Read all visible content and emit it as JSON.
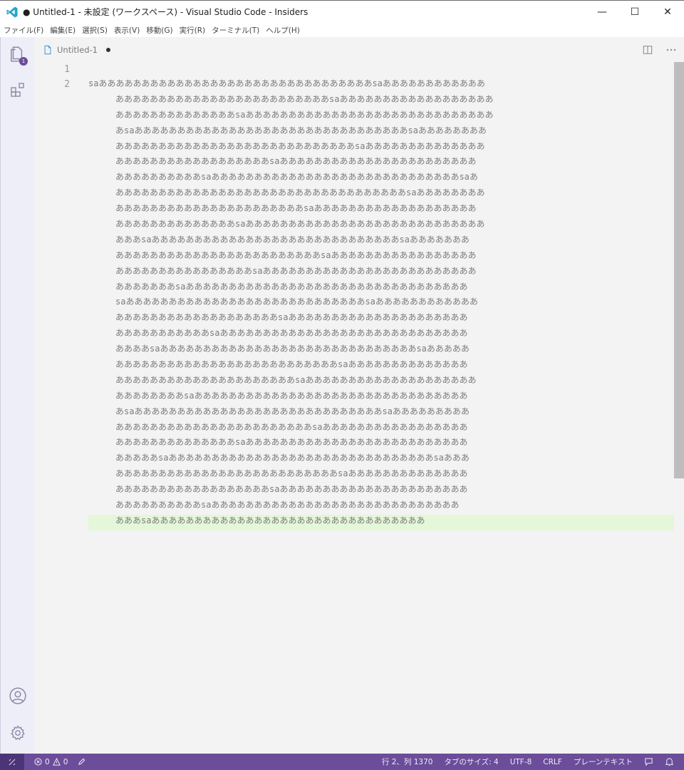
{
  "window": {
    "title": "● Untitled-1 - 未設定 (ワークスペース) - Visual Studio Code - Insiders",
    "controls": {
      "minimize": "—",
      "maximize": "☐",
      "close": "✕"
    }
  },
  "menu": [
    "ファイル(F)",
    "編集(E)",
    "選択(S)",
    "表示(V)",
    "移動(G)",
    "実行(R)",
    "ターミナル(T)",
    "ヘルプ(H)"
  ],
  "activity": {
    "explorer_badge": "1",
    "icons": [
      "explorer-icon",
      "extensions-icon",
      "account-icon",
      "settings-gear-icon"
    ]
  },
  "tab": {
    "label": "Untitled-1",
    "dirty": true
  },
  "editor": {
    "line_numbers": [
      "1",
      "2"
    ],
    "line1": "",
    "line2_visual_rows": [
      "saああああああああああああああああああああああああああああああああsaああああああああああああ",
      "あああああああああああああああああああああああああsaああああああああああああああああああ",
      "ああああああああああああああsaあああああああああああああああああああああああああああああ",
      "あsaああああああああああああああああああああああああああああああああsaああああああああ",
      "ああああああああああああああああああああああああああああsaああああああああああああああ",
      "ああああああああああああああああああsaあああああああああああああああああああああああ",
      "ああああああああああsaあああああああああああああああああああああああああああああsaあ",
      "ああああああああああああああああああああああああああああああああああsaああああああああ",
      "ああああああああああああああああああああああsaあああああああああああああああああああ",
      "ああああああああああああああsaああああああああああああああああああああああああああああ",
      "あああsaあああああああああああああああああああああああああああああsaあああああああ",
      "ああああああああああああああああああああああああsaあああああああああああああああああ",
      "ああああああああああああああああsaあああああああああああああああああああああああああ",
      "あああああああsaあああああああああああああああああああああああああああああああああ",
      "saああああああああああああああああああああああああああああsaああああああああああああ",
      "あああああああああああああああああああsaあああああああああああああああああああああ",
      "あああああああああああsaあああああああああああああああああああああああああああああ",
      "ああああsaああああああああああああああああああああああああああああああsaあああああ",
      "ああああああああああああああああああああああああああsaああああああああああああああ",
      "あああああああああああああああああああああsaああああああああああああああああああああ",
      "ああああああああsaああああああああああああああああああああああああああああああああ",
      "あsaあああああああああああああああああああああああああああああsaあああああああああ",
      "あああああああああああああああああああああああsaあああああああああああああああああ",
      "ああああああああああああああsaああああああああああああああああああああああああああ",
      "あああああsaあああああああああああああああああああああああああああああああsaあああ",
      "ああああああああああああああああああああああああああsaああああああああああああああ",
      "ああああああああああああああああああsaああああああああああああああああああああああ",
      "ああああああああああsaあああああああああああああああああああああああああああああ",
      "あああsaああああああああああああああああああああああああああああああああ"
    ]
  },
  "status": {
    "errors": "0",
    "warnings": "0",
    "position": "行 2、列 1370",
    "tab_size": "タブのサイズ: 4",
    "encoding": "UTF-8",
    "eol": "CRLF",
    "language": "プレーンテキスト"
  },
  "colors": {
    "status_bar": "#6b4d9a",
    "activity_bar": "#eeeef8",
    "editor_bg": "#f3f3f3",
    "current_line": "#e4f7d9",
    "logo": "#22a6c9"
  }
}
